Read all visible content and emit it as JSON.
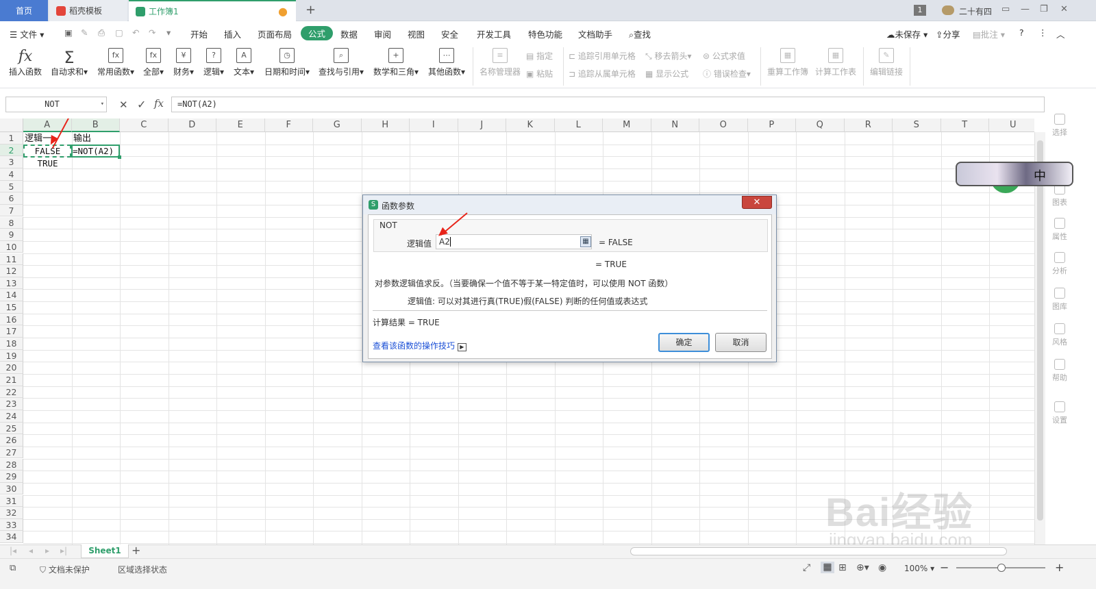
{
  "tabs": [
    {
      "label": "首页"
    },
    {
      "label": "稻壳模板"
    },
    {
      "label": "工作簿1"
    }
  ],
  "user": {
    "badge": "1",
    "name": "二十有四"
  },
  "menu": {
    "file": "文件",
    "items": [
      "开始",
      "插入",
      "页面布局",
      "公式",
      "数据",
      "审阅",
      "视图",
      "安全",
      "开发工具",
      "特色功能",
      "文档助手"
    ],
    "search": "查找",
    "unsaved": "未保存",
    "share": "分享",
    "comment": "批注"
  },
  "ribbon": {
    "insert_fn": "插入函数",
    "autosum": "自动求和",
    "common": "常用函数",
    "all": "全部",
    "finance": "财务",
    "logic": "逻辑",
    "text": "文本",
    "datetime": "日期和时间",
    "lookup": "查找与引用",
    "math": "数学和三角",
    "other": "其他函数",
    "name_mgr": "名称管理器",
    "assign": "指定",
    "paste": "粘贴",
    "trace_prec": "追踪引用单元格",
    "trace_dep": "追踪从属单元格",
    "remove_arrows": "移去箭头",
    "show_formula": "显示公式",
    "eval_formula": "公式求值",
    "error_check": "错误检查",
    "recalc_wb": "重算工作簿",
    "calc_ws": "计算工作表",
    "edit_links": "编辑链接"
  },
  "formula_bar": {
    "name_box": "NOT",
    "fx": "fx",
    "formula": "=NOT(A2)"
  },
  "columns": [
    "A",
    "B",
    "C",
    "D",
    "E",
    "F",
    "G",
    "H",
    "I",
    "J",
    "K",
    "L",
    "M",
    "N",
    "O",
    "P",
    "Q",
    "R",
    "S",
    "T",
    "U"
  ],
  "rows": [
    "1",
    "2",
    "3",
    "4",
    "5",
    "6",
    "7",
    "8",
    "9",
    "10",
    "11",
    "12",
    "13",
    "14",
    "15",
    "16",
    "17",
    "18",
    "19",
    "20",
    "21",
    "22",
    "23",
    "24",
    "25",
    "26",
    "27",
    "28",
    "29",
    "30",
    "31",
    "32",
    "33",
    "34"
  ],
  "cells": {
    "a1": "逻辑一",
    "b1": "输出",
    "a2": "FALSE",
    "b2": "=NOT(A2)",
    "a3": "TRUE"
  },
  "side_panel": [
    "选择",
    "图表",
    "属性",
    "分析",
    "图库",
    "风格",
    "帮助",
    "设置"
  ],
  "ime": "中",
  "dialog": {
    "title": "函数参数",
    "fn_name": "NOT",
    "arg_label": "逻辑值",
    "arg_value": "A2",
    "arg_result": "= FALSE",
    "result_line": "= TRUE",
    "desc": "对参数逻辑值求反。（当要确保一个值不等于某一特定值时，可以使用 NOT 函数）",
    "arg_desc": "逻辑值:  可以对其进行真(TRUE)假(FALSE) 判断的任何值或表达式",
    "calc_result": "计算结果 =  TRUE",
    "help_link": "查看该函数的操作技巧",
    "ok": "确定",
    "cancel": "取消"
  },
  "sheet": {
    "name": "Sheet1"
  },
  "status": {
    "protect": "文档未保护",
    "mode": "区域选择状态",
    "zoom": "100%"
  },
  "watermark": {
    "brand": "Bai经验",
    "url": "jingyan.baidu.com"
  }
}
